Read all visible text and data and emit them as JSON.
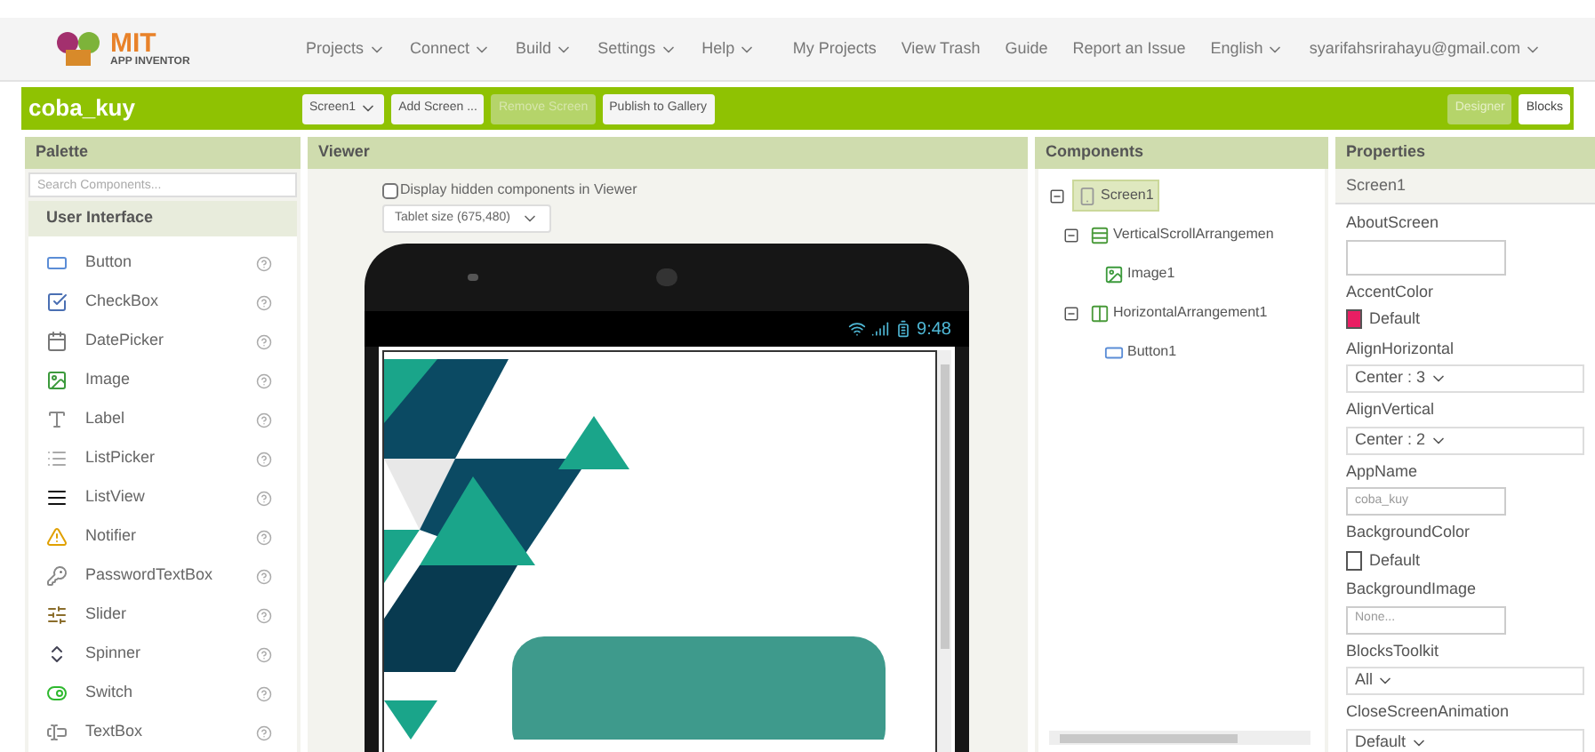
{
  "logo": {
    "title": "MIT",
    "subtitle": "APP INVENTOR"
  },
  "menu": [
    {
      "label": "Projects",
      "dropdown": true
    },
    {
      "label": "Connect",
      "dropdown": true
    },
    {
      "label": "Build",
      "dropdown": true
    },
    {
      "label": "Settings",
      "dropdown": true
    },
    {
      "label": "Help",
      "dropdown": true
    }
  ],
  "right_menu": [
    {
      "label": "My Projects",
      "dropdown": false
    },
    {
      "label": "View Trash",
      "dropdown": false
    },
    {
      "label": "Guide",
      "dropdown": false
    },
    {
      "label": "Report an Issue",
      "dropdown": false
    },
    {
      "label": "English",
      "dropdown": true
    },
    {
      "label": "syarifahsrirahayu@gmail.com",
      "dropdown": true
    }
  ],
  "project": {
    "name": "coba_kuy",
    "buttons": [
      {
        "label": "Screen1",
        "dropdown": true,
        "disabled": false
      },
      {
        "label": "Add Screen ...",
        "dropdown": false,
        "disabled": false
      },
      {
        "label": "Remove Screen",
        "dropdown": false,
        "disabled": true
      },
      {
        "label": "Publish to Gallery",
        "dropdown": false,
        "disabled": false
      }
    ],
    "views": [
      {
        "label": "Designer",
        "selected": true
      },
      {
        "label": "Blocks",
        "selected": false
      }
    ]
  },
  "palette": {
    "title": "Palette",
    "search_placeholder": "Search Components...",
    "category": "User Interface",
    "items": [
      {
        "label": "Button",
        "kind": "button"
      },
      {
        "label": "CheckBox",
        "kind": "checkbox"
      },
      {
        "label": "DatePicker",
        "kind": "datepicker"
      },
      {
        "label": "Image",
        "kind": "image"
      },
      {
        "label": "Label",
        "kind": "label"
      },
      {
        "label": "ListPicker",
        "kind": "listpicker"
      },
      {
        "label": "ListView",
        "kind": "listview"
      },
      {
        "label": "Notifier",
        "kind": "notifier"
      },
      {
        "label": "PasswordTextBox",
        "kind": "password"
      },
      {
        "label": "Slider",
        "kind": "slider"
      },
      {
        "label": "Spinner",
        "kind": "spinner"
      },
      {
        "label": "Switch",
        "kind": "switch"
      },
      {
        "label": "TextBox",
        "kind": "textbox"
      }
    ]
  },
  "viewer": {
    "title": "Viewer",
    "hidden_checkbox": {
      "label": "Display hidden components in Viewer",
      "checked": false
    },
    "size_select": "Tablet size (675,480)",
    "phone_time": "9:48"
  },
  "components": {
    "title": "Components",
    "tree": [
      {
        "label": "Screen1",
        "kind": "screen",
        "selected": true,
        "expanded": true,
        "children": [
          {
            "label": "VerticalScrollArrangemen",
            "kind": "vscroll",
            "selected": false,
            "expanded": true,
            "children": [
              {
                "label": "Image1",
                "kind": "image",
                "selected": false
              }
            ]
          },
          {
            "label": "HorizontalArrangement1",
            "kind": "harrange",
            "selected": false,
            "expanded": true,
            "children": [
              {
                "label": "Button1",
                "kind": "button",
                "selected": false
              }
            ]
          }
        ]
      }
    ]
  },
  "properties": {
    "title": "Properties",
    "subject": "Screen1",
    "items": [
      {
        "label": "AboutScreen",
        "kind": "textarea"
      },
      {
        "label": "AccentColor",
        "kind": "color",
        "value": "Default",
        "color": "#e91e63"
      },
      {
        "label": "AlignHorizontal",
        "kind": "dropdown",
        "value": "Center : 3"
      },
      {
        "label": "AlignVertical",
        "kind": "dropdown",
        "value": "Center : 2"
      },
      {
        "label": "AppName",
        "kind": "text",
        "value": "coba_kuy"
      },
      {
        "label": "BackgroundColor",
        "kind": "color",
        "value": "Default",
        "color": "#ffffff"
      },
      {
        "label": "BackgroundImage",
        "kind": "text",
        "value": "None..."
      },
      {
        "label": "BlocksToolkit",
        "kind": "dropdown",
        "value": "All"
      },
      {
        "label": "CloseScreenAnimation",
        "kind": "dropdown",
        "value": "Default"
      }
    ]
  }
}
